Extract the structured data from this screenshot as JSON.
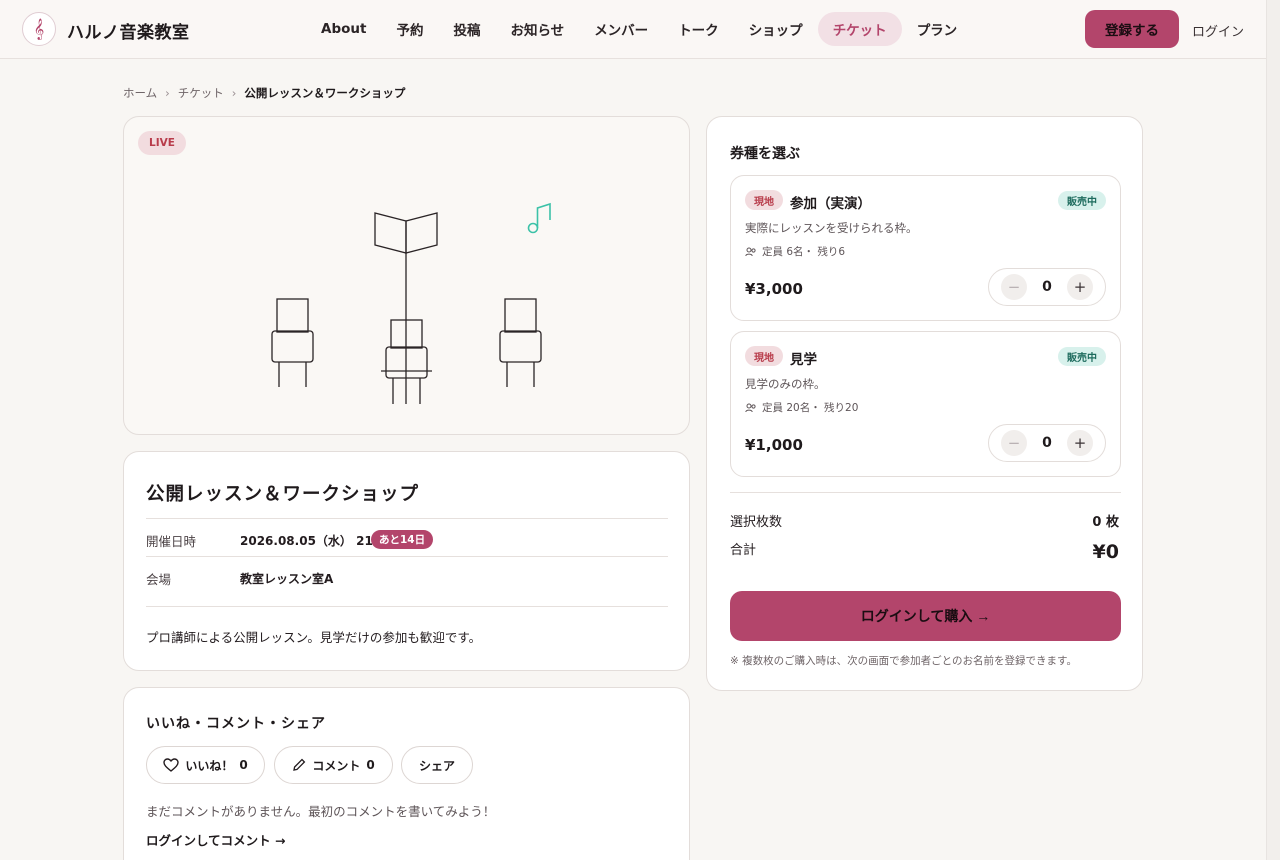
{
  "header": {
    "brand": "ハルノ音楽教室",
    "nav": [
      "About",
      "予約",
      "投稿",
      "お知らせ",
      "メンバー",
      "トーク",
      "ショップ",
      "チケット",
      "プラン"
    ],
    "active_nav": "チケット",
    "register_label": "登録する",
    "login_label": "ログイン"
  },
  "breadcrumb": {
    "home": "ホーム",
    "section": "チケット",
    "current": "公開レッスン＆ワークショップ",
    "separator": "›"
  },
  "hero": {
    "badge": "LIVE"
  },
  "event": {
    "title": "公開レッスン＆ワークショップ",
    "date_label": "開催日時",
    "date_value": "2026.08.05（水） 21:44",
    "days_badge": "あと14日",
    "venue_label": "会場",
    "venue_value": "教室レッスン室A",
    "description": "プロ講師による公開レッスン。見学だけの参加も歓迎です。"
  },
  "social": {
    "title": "いいね・コメント・シェア",
    "like_label": "いいね！",
    "like_count": "0",
    "comment_label": "コメント",
    "comment_count": "0",
    "share_label": "シェア",
    "empty_text": "まだコメントがありません。最初のコメントを書いてみよう！",
    "login_comment": "ログインしてコメント →"
  },
  "panel": {
    "title": "券種を選ぶ",
    "tickets": [
      {
        "tag": "現地",
        "name": "参加（実演）",
        "status": "販売中",
        "desc": "実際にレッスンを受けられる枠。",
        "capacity": "定員 6名・ 残り6",
        "price": "¥3,000",
        "qty": "0"
      },
      {
        "tag": "現地",
        "name": "見学",
        "status": "販売中",
        "desc": "見学のみの枠。",
        "capacity": "定員 20名・ 残り20",
        "price": "¥1,000",
        "qty": "0"
      }
    ],
    "count_label": "選択枚数",
    "count_value": "0 枚",
    "total_label": "合計",
    "total_value": "¥0",
    "buy_label": "ログインして購入 →",
    "note": "※ 複数枚のご購入時は、次の画面で参加者ごとのお名前を登録できます。"
  },
  "colors": {
    "accent": "#b3456b",
    "accent_soft": "#f2e0e5",
    "live_badge": "#f2dcdf",
    "status_badge": "#d8f1ec",
    "note_icon": "#3cc2a8"
  }
}
